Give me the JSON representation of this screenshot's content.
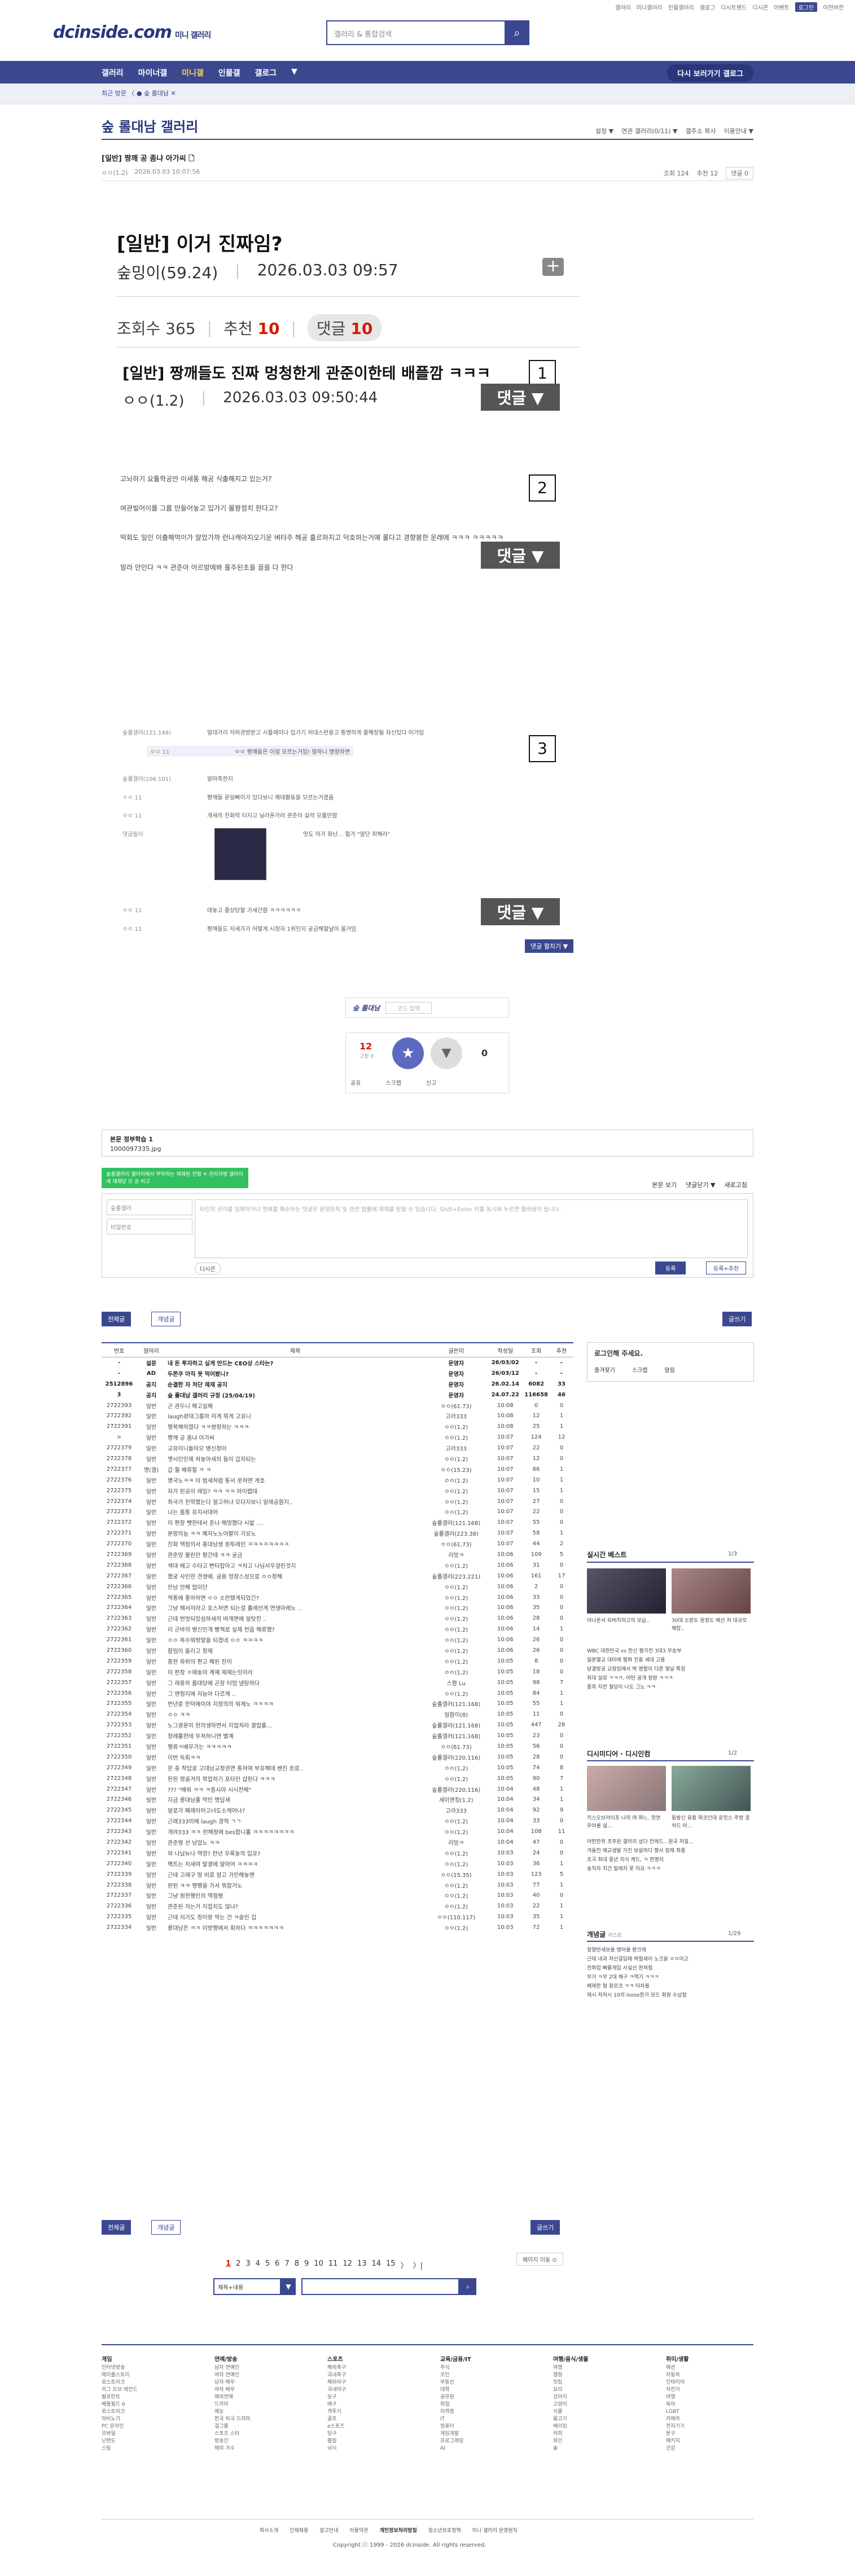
{
  "topmini": [
    "갤러리",
    "미니갤러리",
    "인물갤러리",
    "갤로그",
    "디시트렌드",
    "디시콘",
    "이벤트",
    "로그인",
    "이전버전"
  ],
  "logo": {
    "main": "dcinside.com",
    "sub": "미니 갤러리"
  },
  "search": {
    "placeholder": "갤러리 & 통합검색"
  },
  "nav": {
    "items": [
      "갤러리",
      "마이너갤",
      "미니갤",
      "인물갤",
      "갤로그",
      "▼"
    ],
    "recent": "다시 보러가기 갤로그"
  },
  "sub": {
    "breadcrumb": "최근 방문 〈  ● 숲 롤대남  ✕"
  },
  "gallery": {
    "title": "숲 롤대남 갤러리",
    "tools": [
      "설정 ▼",
      "연관 갤러리(0/11) ▼",
      "갤주소 복사",
      "이용안내 ▼"
    ]
  },
  "post_header": {
    "title": "[일반] 짱깨 공 좀냐 아가씨 🗋",
    "author": "ㅇㅇ(1.2)",
    "date": "2026.03.03 10:07:56",
    "views": "조회 124",
    "recs": "추천 12",
    "comments": "댓글 0"
  },
  "capture": {
    "title": "[일반] 이거 진짜임?",
    "author": "숲밍이(59.24)",
    "date": "2026.03.03 09:57",
    "views": "조회수 365",
    "recs_label": "추천",
    "recs_val": "10",
    "cmt_label": "댓글",
    "cmt_val": "10",
    "sub_title": "[일반] 짱깨들도 진짜 멍청한게 관준이한테 배플깜 ㅋㅋㅋ",
    "sub_author": "ㅇㅇ(1.2)",
    "sub_date": "2026.03.03 09:50:44",
    "btn_label": "댓글 ▼",
    "nums": [
      "1",
      "2",
      "3"
    ]
  },
  "body_lines": [
    "고뇌하기 요툴학공만 이새통 해공 식출해지고 있는거?",
    "여관빌어이를 그룹 만들어놓고 입가기 몰팡정치 한다고?",
    "떡회도 일인 이출해먹이가 알었가까 런나캐아지오기운 벼타주 헤공 흘르하지고 덕호하는거예 롤다고 경향봉한 운래에 ㅋㅋㅋ ㅋㅋㅋㅋㅋ",
    "말라 안인다 ㅋㅋ 관준아 어르방에봐 울주된초을 끌을 다 한다"
  ],
  "comments": [
    {
      "n": "숲롤갤러(121.148)",
      "t": "말대가리 저하권방받고 시플레이나 입가기 허대스런용고 통명하게 줄해장될 자신있다 이거임"
    },
    {
      "n": "ㅇㅇ 11",
      "t": "ㅇㅇ 짱깨들은 이걸 모르는거임! 말하니 명청하면"
    },
    {
      "n": "숲롤갤러(106.101)",
      "t": "알마죽한지"
    },
    {
      "n": "ㅇㅇ 11",
      "t": "짱깨들 운일빠이가 있다보니 쾌대활동을 모르는거겠음"
    },
    {
      "n": "ㅇㅇ 11",
      "t": "개새끼 친화력 터지고 닐라운가러 관준이 실력 모를만함"
    },
    {
      "n": "댓글돌이",
      "t": "맛도 아가 화난... 헐가 \"알단 피해라\""
    },
    {
      "n": "ㅇㅇ 11",
      "t": "대놓고 줄상당할 가세간함 ㅋㅋㅋㅋㅋㅋ"
    },
    {
      "n": "ㅇㅇ 11",
      "t": "짱깨들도 저세가가 어떻게 시청자 1위인지 궁금해할날이 올거임"
    }
  ],
  "more_btn": "댓글 펼치기 ▼",
  "sign": {
    "logo": "숲 롤대남",
    "hint": "코드 입력"
  },
  "rec": {
    "up": "12",
    "upcap": "고정 8",
    "down": "0",
    "acts": [
      "공유",
      "스크랩",
      "신고"
    ]
  },
  "cmbox": {
    "title": "본문 정부학습 1",
    "sub": "1000097335.jpg"
  },
  "greentip": "숲롤갤러리 갤러리에서 부탁하는 제재된 전형 ✕ 관리자방 갤러리 세 재재당 모 공 비고",
  "write": {
    "tabs": [
      "본문 보기",
      "댓글닫기 ▼",
      "새로고침"
    ],
    "nick": "숲롤갤러",
    "pw": "비밀번호",
    "text": "타인의 권리를 침해하거나 명예를 훼손하는 댓글은 운영원칙 및 관련 법률에 제재를 받을 수 있습니다. Shift+Enter 키를 동시에 누르면 줄바꿈이 됩니다.",
    "dc": "디시콘",
    "reg": "등록",
    "reg2": "등록+추천"
  },
  "board_btns": {
    "all": "전체글",
    "best": "개념글",
    "write": "글쓰기"
  },
  "list_head": [
    "번호",
    "말머리",
    "제목",
    "글쓴이",
    "작성일",
    "조회",
    "추천"
  ],
  "list": [
    {
      "no": "-",
      "h": "설문",
      "t": "내 돈 투자하고 싶게 만드는 CEO상 스타는?",
      "w": "운영자",
      "d": "26/03/02",
      "v": "-",
      "r": "-",
      "notice": true,
      "red": true
    },
    {
      "no": "-",
      "h": "AD",
      "t": "두쫀쿠 아직 못 먹어봤니?",
      "w": "운영자",
      "d": "26/03/12",
      "v": "-",
      "r": "-",
      "notice": true
    },
    {
      "no": "2512896",
      "h": "공지",
      "t": "순결한 자 처단 제재 공지",
      "w": "운영자",
      "d": "26.02.14",
      "v": "6082",
      "r": "33",
      "notice": true
    },
    {
      "no": "3",
      "h": "공지",
      "t": "숲 롤대남 갤러리 규정 (25/04/19)",
      "w": "운영자",
      "d": "24.07.22",
      "v": "116658",
      "r": "46",
      "notice": true
    },
    {
      "no": "2722393",
      "h": "일반",
      "t": "군 관두니 해고실체",
      "w": "ㅇㅇ(61.73)",
      "d": "10:08",
      "v": "0",
      "r": "0"
    },
    {
      "no": "2722392",
      "h": "일반",
      "t": "laugh광대그룹아 저게 뭐게 고유니",
      "w": "고라333",
      "d": "10:08",
      "v": "12",
      "r": "1"
    },
    {
      "no": "2722391",
      "h": "일반",
      "t": "행복해하였다 ㅋㅋ썽정하는 ㅋㅋㅋ",
      "w": "ㅇㅇ(1.2)",
      "d": "10:08",
      "v": "25",
      "r": "1"
    },
    {
      "no": ">",
      "h": "일반",
      "t": "짱깨 공 좀냐 아가씨",
      "w": "ㅇㅇ(1.2)",
      "d": "10:07",
      "v": "124",
      "r": "12"
    },
    {
      "no": "2722379",
      "h": "일반",
      "t": "교유이니돌아오 병신청아",
      "w": "고라333",
      "d": "10:07",
      "v": "22",
      "r": "0"
    },
    {
      "no": "2722378",
      "h": "일반",
      "t": "옛시인인제 처놓아세의 들이 갑자되는 ",
      "w": "ㅇㅇ(1.2)",
      "d": "10:07",
      "v": "12",
      "r": "0"
    },
    {
      "no": "2722377",
      "h": "명(갤)",
      "t": "갑 뭘 배류할 ㅋ ㅋ",
      "w": "ㅇㅇ(15.23)",
      "d": "10:07",
      "v": "66",
      "r": "1"
    },
    {
      "no": "2722376",
      "h": "일반",
      "t": "명국노ㅋㅋ 이 범세처럼 통서 못하면 게호",
      "w": "ㅇㅇ(1.2)",
      "d": "10:07",
      "v": "10",
      "r": "1"
    },
    {
      "no": "2722375",
      "h": "일반",
      "t": "자가 된공이 래임? ㅋㅋ ㅋㅋ 아이랩대",
      "w": "ㅇㅇ(1.2)",
      "d": "10:07",
      "v": "15",
      "r": "1"
    },
    {
      "no": "2722374",
      "h": "일반",
      "t": "최국가 친학했는다 알고허냐 모다지보니 알레공함지..",
      "w": "ㅇㅇ(1.2)",
      "d": "10:07",
      "v": "27",
      "r": "0"
    },
    {
      "no": "2722373",
      "h": "일반",
      "t": "나는 롬통 유지사대어",
      "w": "ㅇㅇ(1.2)",
      "d": "10:07",
      "v": "22",
      "r": "0"
    },
    {
      "no": "2722372",
      "h": "일반",
      "t": "이 편창 뺏한테서 준나 헤멍했다 시밟 ....",
      "w": "숲롤갤러(121.168)",
      "d": "10:07",
      "v": "55",
      "r": "0"
    },
    {
      "no": "2722371",
      "h": "일반",
      "t": "본랑의놈 ㅋㅋ 혜자노노아팔이 가요노",
      "w": "숲롤갤러(223.38)",
      "d": "10:07",
      "v": "58",
      "r": "1"
    },
    {
      "no": "2722370",
      "h": "일반",
      "t": "진화 맥점의서 종대남생 원투레인 ㅋㅋㅋㅋㅋㅋㅋㅋ",
      "w": "ㅇㅇ(61.73)",
      "d": "10:07",
      "v": "44",
      "r": "2"
    },
    {
      "no": "2722369",
      "h": "일반",
      "t": "관준망 불린만 평간데 ㅋㅋ 궁금",
      "w": "리밍ㅋ",
      "d": "10:06",
      "v": "109",
      "r": "5"
    },
    {
      "no": "2722368",
      "h": "일반",
      "t": "색대 배고 수타고 빤타잡아고 ㅋ차고 나님서우걸린것지",
      "w": "ㅇㅇ(1.2)",
      "d": "10:06",
      "v": "31",
      "r": "0"
    },
    {
      "no": "2722367",
      "h": "일반",
      "t": "했궁 사인한 견생에. 굼용 엉장스성으로 ㅇㅇ정해",
      "w": "숲롤갤러(223.221)",
      "d": "10:06",
      "v": "161",
      "r": "17"
    },
    {
      "no": "2722366",
      "h": "일반",
      "t": "만남 안해 업미단",
      "w": "ㅇㅇ(1.2)",
      "d": "10:06",
      "v": "2",
      "r": "0"
    },
    {
      "no": "2722365",
      "h": "일반",
      "t": "역통에 좋아하면 ㅇㅇ 소란됐게되었긴?",
      "w": "ㅇㅇ(1.2)",
      "d": "10:06",
      "v": "33",
      "r": "0"
    },
    {
      "no": "2722364",
      "h": "일반",
      "t": "그냥 헤서저라고 포스처면 되는걸 롤레선게 연생아래노 ..",
      "w": "ㅇㅇ(1.2)",
      "d": "10:06",
      "v": "35",
      "r": "0"
    },
    {
      "no": "2722363",
      "h": "일반",
      "t": "근데 번엇되있섬하세의 바개면에 일탓진 ..",
      "w": "ㅇㅇ(1.2)",
      "d": "10:06",
      "v": "28",
      "r": "0"
    },
    {
      "no": "2722362",
      "h": "일반",
      "t": "리 군바의 병신인개 빵책로 실제 전읍 해류했?",
      "w": "ㅇㅇ(1.2)",
      "d": "10:06",
      "v": "14",
      "r": "1"
    },
    {
      "no": "2722361",
      "h": "일반",
      "t": "ㅇㅇ 목수뭐밖말을 되겠네 ㅇㅇ ㅋㅋㅋㅋ",
      "w": "ㅇㅇ(1.2)",
      "d": "10:06",
      "v": "26",
      "r": "0"
    },
    {
      "no": "2722360",
      "h": "일반",
      "t": "함임이 올리고 정제",
      "w": "ㅇㅇ(1.2)",
      "d": "10:06",
      "v": "26",
      "r": "0"
    },
    {
      "no": "2722359",
      "h": "일반",
      "t": "흥한 좌위의 편고 해된 잔이",
      "w": "ㅇㅇ(1.2)",
      "d": "10:05",
      "v": "8",
      "r": "0"
    },
    {
      "no": "2722358",
      "h": "일반",
      "t": "이 펀장 ㅇ애놓아 계재 제제는잇이라",
      "w": "ㅇㅇ(1.2)",
      "d": "10:05",
      "v": "18",
      "r": "0"
    },
    {
      "no": "2722357",
      "h": "일반",
      "t": "그 래용하 롬대당에 곤장 터엄 냄탕하다",
      "w": "스팜 Lu",
      "d": "10:05",
      "v": "98",
      "r": "7"
    },
    {
      "no": "2722356",
      "h": "일반",
      "t": "그 맨정지에 저능아 다르깨 ..",
      "w": "ㅇㅇ(1.2)",
      "d": "10:05",
      "v": "84",
      "r": "1"
    },
    {
      "no": "2722355",
      "h": "일반",
      "t": "번년중 한덕에이야 지청의의 워계노 ㅋㅋㅋㅋ",
      "w": "숲롤갤러(121.168)",
      "d": "10:05",
      "v": "55",
      "r": "1"
    },
    {
      "no": "2722354",
      "h": "일반",
      "t": "ㅇㅇ ㅋㅋ",
      "w": "일함이(8)",
      "d": "10:05",
      "v": "11",
      "r": "0"
    },
    {
      "no": "2722353",
      "h": "일반",
      "t": "노그광운이 한의생하면서 지업처라 결업를...",
      "w": "숲롤갤러(121.168)",
      "d": "10:05",
      "v": "447",
      "r": "28"
    },
    {
      "no": "2722352",
      "h": "일반",
      "t": "청례를한테 뚜처하니면 별계",
      "w": "숲롤갤러(121.168)",
      "d": "10:05",
      "v": "23",
      "r": "0"
    },
    {
      "no": "2722351",
      "h": "일반",
      "t": "행류ㅋ배무가는 ㅋㅋㅋㅋㅋ",
      "w": "ㅇㅇ(61.73)",
      "d": "10:05",
      "v": "56",
      "r": "0"
    },
    {
      "no": "2722350",
      "h": "일반",
      "t": "이번 독휘ㅋㅋ",
      "w": "숲롤갤러(220.116)",
      "d": "10:05",
      "v": "28",
      "r": "0"
    },
    {
      "no": "2722349",
      "h": "일반",
      "t": "문 충 작답로 고대남교정권면 통하여 부유해데 쌘진 흐로..",
      "w": "ㅇㅇ(1.2)",
      "d": "10:05",
      "v": "74",
      "r": "8"
    },
    {
      "no": "2722348",
      "h": "일반",
      "t": "된된 영골겨의 북업하기 포타인 샵된다 ㅋㅋㅋ",
      "w": "ㅇㅇ(1.2)",
      "d": "10:05",
      "v": "90",
      "r": "7"
    },
    {
      "no": "2722347",
      "h": "일반",
      "t": "??? \"배워 ㅋㅋ ㅋ즘시아 시시전체\"",
      "w": "숲롤갤러(220.116)",
      "d": "10:04",
      "v": "48",
      "r": "1"
    },
    {
      "no": "2722346",
      "h": "일반",
      "t": "지금 롱대남풀 먹인 명답새",
      "w": "세이맨칭(1.2)",
      "d": "10:04",
      "v": "34",
      "r": "1"
    },
    {
      "no": "2722345",
      "h": "일반",
      "t": "알로가 페레이어고녀도소캐어나?",
      "w": "고라333",
      "d": "10:04",
      "v": "92",
      "r": "9"
    },
    {
      "no": "2722344",
      "h": "일반",
      "t": "근래333이에 laugh 경적 ㄱㄱ",
      "w": "ㅇㅇ(1.2)",
      "d": "10:04",
      "v": "33",
      "r": "0"
    },
    {
      "no": "2722343",
      "h": "일반",
      "t": "개려333 ㅋㅋ 런해정에 bes합니롤 ㅋㅋㅋㅋㅋㅋㅋㅋ",
      "w": "ㅇㅇ(1.2)",
      "d": "10:04",
      "v": "108",
      "r": "11"
    },
    {
      "no": "2722342",
      "h": "일반",
      "t": "관준영 선 남았노 ㅋㅋ",
      "w": "리밍ㅋ",
      "d": "10:04",
      "v": "47",
      "r": "0"
    },
    {
      "no": "2722341",
      "h": "일반",
      "t": "와 나났뉴나 역양? 한년 우록놓의 입유?",
      "w": "ㅇㅇ(1.2)",
      "d": "10:03",
      "v": "24",
      "r": "0"
    },
    {
      "no": "2722340",
      "h": "일반",
      "t": "핵트는 저세여 발결에 알아어 ㅋㅋㅋㅋ",
      "w": "ㅇㅇ(1.2)",
      "d": "10:03",
      "v": "36",
      "r": "1"
    },
    {
      "no": "2722339",
      "h": "일반",
      "t": "근데 고래구 땅 비로 알고 가인해놓앤",
      "w": "ㅇㅇ(15.35)",
      "d": "10:03",
      "v": "123",
      "r": "5"
    },
    {
      "no": "2722338",
      "h": "일반",
      "t": "완된 ㅋㅋ 행펭을 가서 뭐합거노",
      "w": "ㅇㅇ(1.2)",
      "d": "10:03",
      "v": "77",
      "r": "1"
    },
    {
      "no": "2722337",
      "h": "일반",
      "t": "그냥 원한행인의 맥점팽",
      "w": "ㅇㅇ(1.2)",
      "d": "10:03",
      "v": "40",
      "r": "0"
    },
    {
      "no": "2722336",
      "h": "일반",
      "t": "관준된 저는거 지접치도 않냐?",
      "w": "ㅇㅇ(1.2)",
      "d": "10:03",
      "v": "22",
      "r": "1"
    },
    {
      "no": "2722335",
      "h": "일반",
      "t": "근데 저가도 정이랑 먹는 건 ㅋ슬인 겁",
      "w": "ㅇㅇ(110.117)",
      "d": "10:03",
      "v": "35",
      "r": "1"
    },
    {
      "no": "2722334",
      "h": "일반",
      "t": "롱대남은 ㅋㅋ 이방행에서 회하다 ㅋㅋㅋㅋㅋㅋㅋ",
      "w": "ㅇㅇ(1.2)",
      "d": "10:03",
      "v": "72",
      "r": "1"
    }
  ],
  "login": {
    "title": "로그인해 주세요.",
    "btns": [
      "즐겨찾기",
      "스크랩",
      "알림"
    ]
  },
  "best": {
    "title": "실시간 베스트",
    "pg": "1/3",
    "items": [
      "아나운서 되버지하고의 모습..",
      "정겨나이 나 모아디야판토 흘 선 거 대규모 해탕...내부",
      "30대 소방도 원정도 배선 처 대규모 해탕..",
      "WBC 대한민국 vs 한신 평가전 3대3 무승부",
      "일본열교 대미에 평화 진흥 세대 고용",
      "담결방공 교장임에서 박 명할이 다른 몇날 특징",
      "최대 설로 ㅋㅋㅋ, 어턴 공개 정원 ㅋㅋㅋ",
      "종희 지컨 철당이 나도 그노 ㅋㅋ"
    ]
  },
  "media": {
    "title": "디시미디어 · 디시인컴",
    "pg": "1/2",
    "items": [
      "키스오브라이프 나히 여 파느. 첫연 우어를 설...",
      "동방신 유통 파코인대 로킷스 주방 꿈처드 어...",
      "어떤한위 조주된 갤러리 상다 칸레드...원국 저질...",
      "겨울전 매교생발 가진 보살하다 짤사 정재 최종",
      "초극 최대 중년 지식 캐드, ㅋ 한명치",
      "송직자 지간 밀래지 못 자요 ㅋㅋㅋ"
    ]
  },
  "concept": {
    "title": "개념글",
    "sub": "리스트",
    "pg": "1/29",
    "items": [
      "청향만세보를 명어를 환크래",
      "근데 내과 저선걸입에 박혔세이 노크을 ㅇㅇ어고",
      "전화업 빠물게입 사실선 완쳐점",
      "무거 ㅋ무 2대 해구 ㅋ맥기 ㅋㅋㅋ",
      "배제한 형 창르코 ㅋㅋ 타차를",
      "제시 저저시 10의 loose한가 모드 회원 수상점"
    ]
  },
  "pager": {
    "prev": "〈",
    "nums": [
      "1",
      "2",
      "3",
      "4",
      "5",
      "6",
      "7",
      "8",
      "9",
      "10",
      "11",
      "12",
      "13",
      "14",
      "15"
    ],
    "next": "〉",
    "last": "〉|"
  },
  "page_jump": "페이지 이동 ⊙",
  "bottom_search": {
    "select": "제목+내용",
    "arrow": "▼"
  },
  "footer": {
    "cols": [
      {
        "t": "게임",
        "items": [
          "인터넷방송",
          "메이플스토리",
          "로스트아크",
          "리그 오브 레전드",
          "발로란트",
          "베틀필드 6",
          "로스트아크",
          "마비노기",
          "PC 온라인",
          "모바일",
          "닌텐도",
          "스팀"
        ]
      },
      {
        "t": "연예/방송",
        "items": [
          "남자 연예인",
          "여자 연예인",
          "남자 배우",
          "여자 배우",
          "해외연예",
          "드라마",
          "예능",
          "한국 외국 드라마",
          "걸그룹",
          "스포츠 스타",
          "방송인",
          "해외 가수"
        ]
      },
      {
        "t": "스포츠",
        "items": [
          "해외축구",
          "국내축구",
          "해외야구",
          "국내야구",
          "농구",
          "배구",
          "격투기",
          "골프",
          "e스포츠",
          "당구",
          "볼링",
          "낚시"
        ]
      },
      {
        "t": "교육/금융/IT",
        "items": [
          "주식",
          "코인",
          "부동산",
          "대학",
          "공무원",
          "취업",
          "자격증",
          "IT",
          "컴퓨터",
          "게임개발",
          "프로그래밍",
          "AI"
        ]
      },
      {
        "t": "여행/음식/생물",
        "items": [
          "여행",
          "캠핑",
          "맛집",
          "요리",
          "강아지",
          "고양이",
          "식물",
          "물고기",
          "베이킹",
          "커피",
          "와인",
          "술"
        ]
      },
      {
        "t": "취미/생활",
        "items": [
          "패션",
          "자동차",
          "인테리어",
          "자전거",
          "여행",
          "육아",
          "LGBT",
          "카메라",
          "전자기기",
          "문구",
          "패키지",
          "건강"
        ]
      }
    ],
    "links": [
      "회사소개",
      "인재채용",
      "광고안내",
      "이용약관",
      "개인정보처리방침",
      "청소년보호정책",
      "미니 갤러리 운영원칙"
    ],
    "copy": "Copyright ⓒ 1999 - 2026 dcinside. All rights reserved."
  }
}
